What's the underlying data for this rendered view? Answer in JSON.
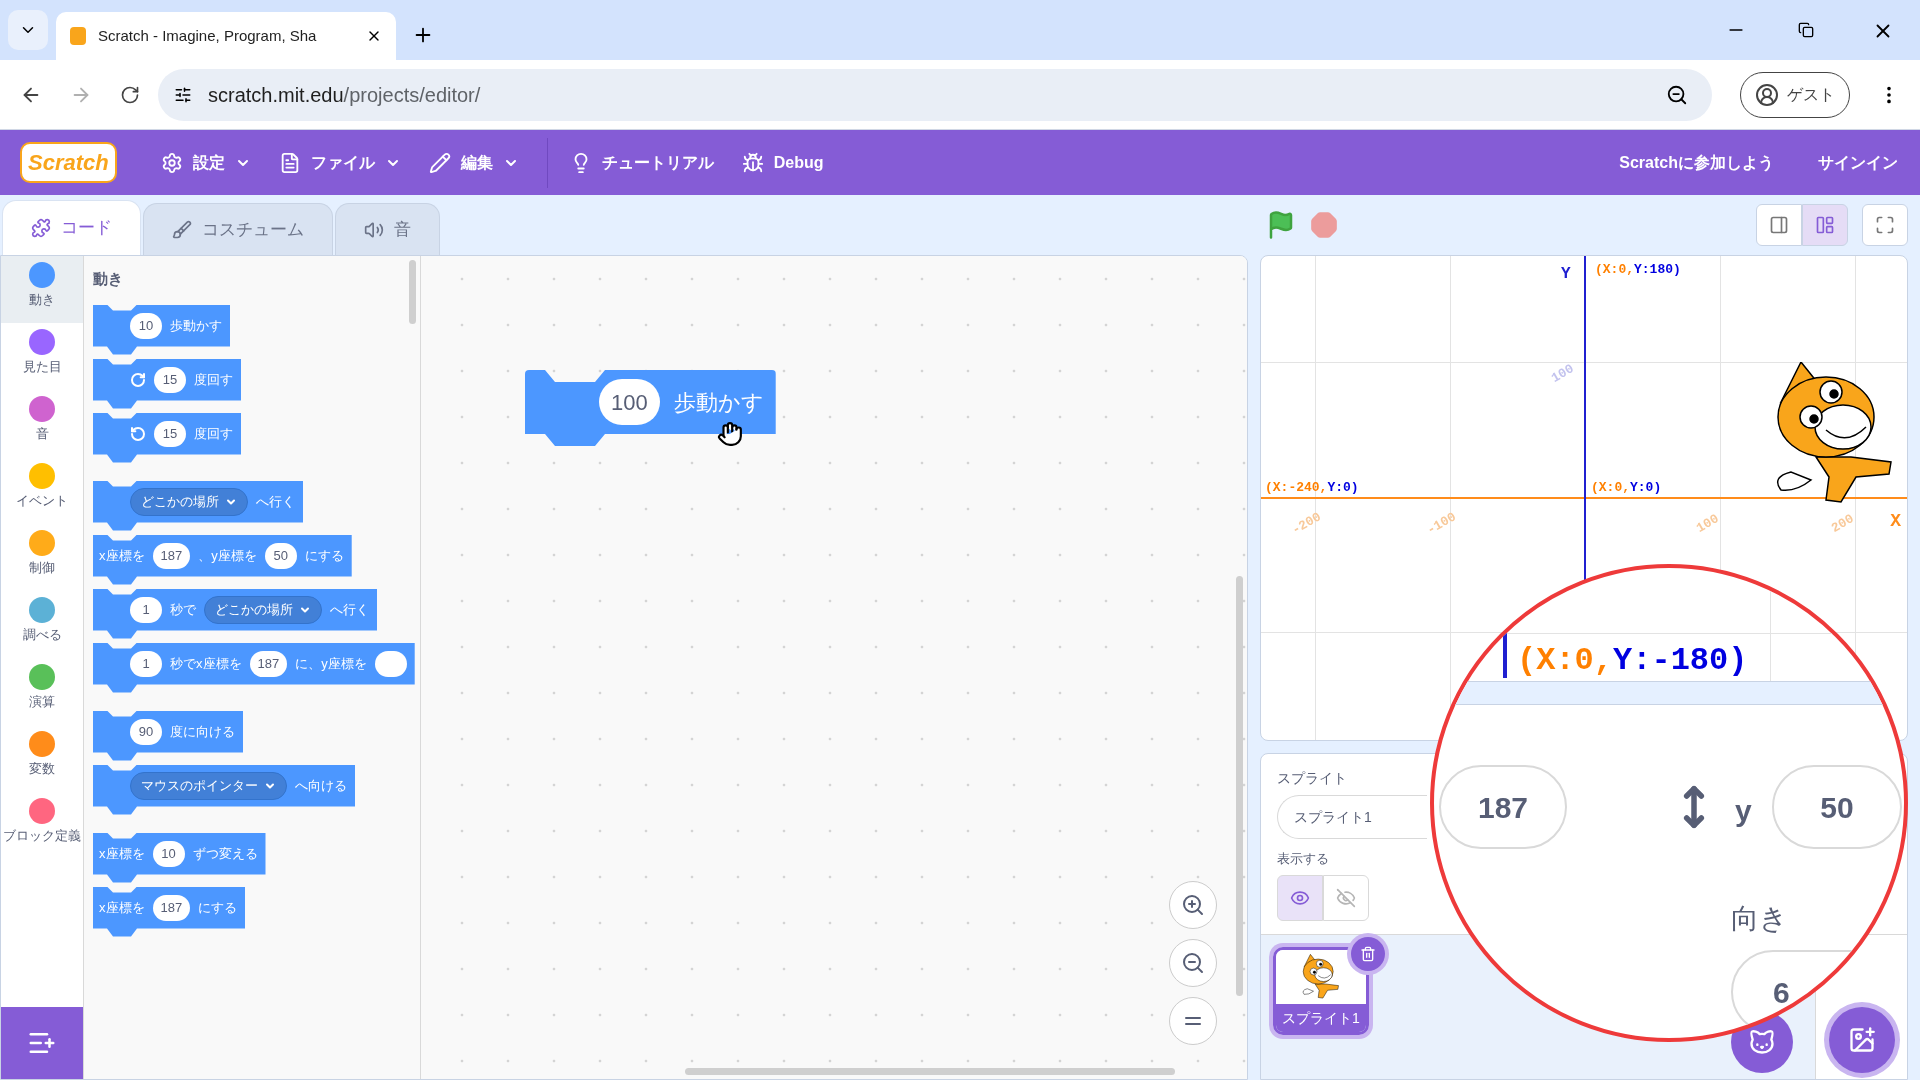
{
  "browser": {
    "tab_title": "Scratch - Imagine, Program, Sha",
    "url_host": "scratch.mit.edu",
    "url_path": "/projects/editor/",
    "profile": "ゲスト"
  },
  "menu_bar": {
    "logo": "Scratch",
    "items": [
      {
        "kind": "settings",
        "label": "設定",
        "dropdown": true
      },
      {
        "kind": "file",
        "label": "ファイル",
        "dropdown": true
      },
      {
        "kind": "edit",
        "label": "編集",
        "dropdown": true
      },
      {
        "kind": "tutorial",
        "label": "チュートリアル",
        "dropdown": false
      },
      {
        "kind": "debug",
        "label": "Debug",
        "dropdown": false
      }
    ],
    "join": "Scratchに参加しよう",
    "sign_in": "サインイン"
  },
  "editor_tabs": [
    {
      "kind": "code",
      "label": "コード",
      "selected": true
    },
    {
      "kind": "costume",
      "label": "コスチューム",
      "selected": false
    },
    {
      "kind": "sound",
      "label": "音",
      "selected": false
    }
  ],
  "categories": [
    {
      "label": "動き",
      "color": "#4c97ff",
      "selected": true
    },
    {
      "label": "見た目",
      "color": "#9966ff",
      "selected": false
    },
    {
      "label": "音",
      "color": "#cf63cf",
      "selected": false
    },
    {
      "label": "イベント",
      "color": "#ffbf00",
      "selected": false
    },
    {
      "label": "制御",
      "color": "#ffab19",
      "selected": false
    },
    {
      "label": "調べる",
      "color": "#5cb1d6",
      "selected": false
    },
    {
      "label": "演算",
      "color": "#59c059",
      "selected": false
    },
    {
      "label": "変数",
      "color": "#ff8c1a",
      "selected": false
    },
    {
      "label": "ブロック定義",
      "color": "#ff6680",
      "selected": false
    }
  ],
  "palette": {
    "heading": "動き",
    "groups": [
      {
        "blocks": [
          {
            "parts": [
              {
                "kind": "number",
                "text": "10"
              },
              {
                "kind": "text",
                "text": "歩動かす"
              }
            ]
          },
          {
            "parts": [
              {
                "kind": "turn_right"
              },
              {
                "kind": "number",
                "text": "15"
              },
              {
                "kind": "text",
                "text": "度回す"
              }
            ]
          },
          {
            "parts": [
              {
                "kind": "turn_left"
              },
              {
                "kind": "number",
                "text": "15"
              },
              {
                "kind": "text",
                "text": "度回す"
              }
            ]
          }
        ]
      },
      {
        "blocks": [
          {
            "parts": [
              {
                "kind": "dropdown",
                "text": "どこかの場所"
              },
              {
                "kind": "text",
                "text": "へ行く"
              }
            ]
          },
          {
            "parts": [
              {
                "kind": "text",
                "text": "x座標を"
              },
              {
                "kind": "number",
                "text": "187"
              },
              {
                "kind": "text",
                "text": "、y座標を"
              },
              {
                "kind": "number",
                "text": "50"
              },
              {
                "kind": "text",
                "text": "にする"
              }
            ]
          },
          {
            "parts": [
              {
                "kind": "number",
                "text": "1"
              },
              {
                "kind": "text",
                "text": "秒で"
              },
              {
                "kind": "dropdown",
                "text": "どこかの場所"
              },
              {
                "kind": "text",
                "text": "へ行く"
              }
            ]
          },
          {
            "parts": [
              {
                "kind": "number",
                "text": "1"
              },
              {
                "kind": "text",
                "text": "秒でx座標を"
              },
              {
                "kind": "number",
                "text": "187"
              },
              {
                "kind": "text",
                "text": "に、y座標を"
              },
              {
                "kind": "cut_pill"
              }
            ]
          }
        ]
      },
      {
        "blocks": [
          {
            "parts": [
              {
                "kind": "number",
                "text": "90"
              },
              {
                "kind": "text",
                "text": "度に向ける"
              }
            ]
          },
          {
            "parts": [
              {
                "kind": "dropdown",
                "text": "マウスのポインター"
              },
              {
                "kind": "text",
                "text": "へ向ける"
              }
            ]
          }
        ]
      },
      {
        "blocks": [
          {
            "parts": [
              {
                "kind": "text",
                "text": "x座標を"
              },
              {
                "kind": "number",
                "text": "10"
              },
              {
                "kind": "text",
                "text": "ずつ変える"
              }
            ]
          },
          {
            "parts": [
              {
                "kind": "text",
                "text": "x座標を"
              },
              {
                "kind": "number",
                "text": "187"
              },
              {
                "kind": "text",
                "text": "にする"
              }
            ]
          }
        ]
      }
    ]
  },
  "script": {
    "parts": [
      {
        "kind": "number",
        "text": "100"
      },
      {
        "kind": "text",
        "text": "歩動かす"
      }
    ]
  },
  "stage": {
    "axis_x": "X",
    "axis_y": "Y",
    "coordinates": [
      {
        "x_part": "(X:0,",
        "y_part": "Y:180)"
      },
      {
        "x_part": "(X:-240,",
        "y_part": "Y:0)"
      },
      {
        "x_part": "(X:0,",
        "y_part": "Y:0)"
      }
    ],
    "x_ticks": [
      "-200",
      "-100",
      "100",
      "200"
    ],
    "y_ticks": [
      "100"
    ]
  },
  "sprite_panel": {
    "sprite_label": "スプライト",
    "sprite_name": "スプライト1",
    "show_label": "表示する",
    "visibility": [
      {
        "kind": "show",
        "selected": true
      },
      {
        "kind": "hide",
        "selected": false
      }
    ],
    "sprites": [
      {
        "name": "スプライト1",
        "selected": true
      }
    ]
  },
  "magnifier": {
    "coordinate": {
      "x_part": "(X:0,",
      "y_part": "Y:-180)"
    },
    "x_value": "187",
    "y_label": "y",
    "y_value": "50",
    "direction_label": "向き",
    "direction_value": "6"
  }
}
